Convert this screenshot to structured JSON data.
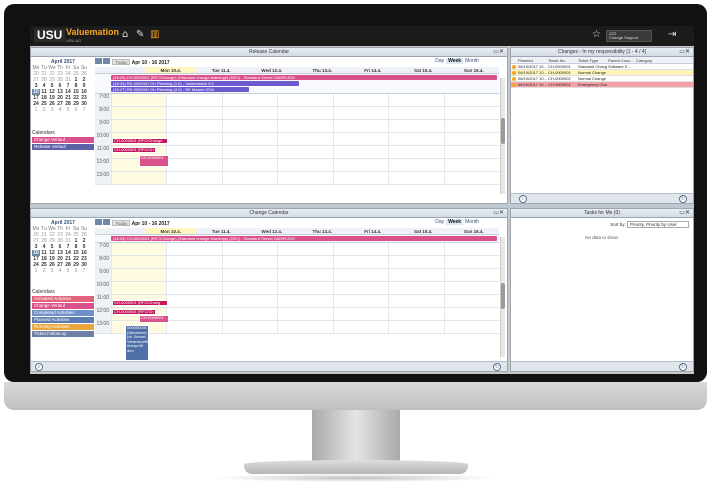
{
  "app": {
    "logo": "USU",
    "product": "Valuemation",
    "sub_product": "USU AG",
    "home_icon": "home-icon",
    "user_name": "ZZZ",
    "user_role": "Change Support",
    "star_icon": "star-icon",
    "logout_icon": "logout-icon"
  },
  "release_calendar": {
    "title": "Release Calendar",
    "range": "Apr 10 - 16 2017",
    "today_label": "Today",
    "views": [
      "Day",
      "Week",
      "Month"
    ],
    "active_view": "Week",
    "days": [
      "Mon 10.4.",
      "Tue 11.4.",
      "Wed 12.4.",
      "Thu 13.4.",
      "Fri 14.4.",
      "Sat 15.4.",
      "Sun 16.4."
    ],
    "hours": [
      "7:00",
      "8:00",
      "9:00",
      "10:00",
      "11:00",
      "12:00",
      "13:00"
    ],
    "all_day": [
      {
        "label": "(18:25) CH-0000001 (RFC/Change) (Standard change learnings) (DEV) - Standard Server SAMPLE00",
        "color": "#d9508a"
      },
      {
        "label": "(18:34) RE-0000001 On Planning (1.0) - Valuemation 5.0",
        "color": "#6a5acd"
      },
      {
        "label": "(18:27) RE-0000001 On Planning (4.0) - RE Master 2016",
        "color": "#6a5acd"
      }
    ],
    "events": [
      {
        "label": "CH-0000001 (RFC/Change",
        "color": "#c2185b"
      },
      {
        "label": "CH-0000001 (RFC/Ch",
        "color": "#c2185b"
      },
      {
        "label": "CH-0000001",
        "color": "#d9508a"
      }
    ],
    "mini_month": "April 2017",
    "calendars_label": "Calendars",
    "calendars": [
      {
        "label": "Change Verlauf",
        "color": "#d9508a"
      },
      {
        "label": "Release Verlauf",
        "color": "#5b62a8"
      }
    ]
  },
  "change_calendar": {
    "title": "Change Calendar",
    "range": "Apr 10 - 16 2017",
    "today_label": "Today",
    "views": [
      "Day",
      "Week",
      "Month"
    ],
    "active_view": "Week",
    "days": [
      "Mon 10.4.",
      "Tue 11.4.",
      "Wed 12.4.",
      "Thu 13.4.",
      "Fri 14.4.",
      "Sat 15.4.",
      "Sun 16.4."
    ],
    "hours": [
      "7:00",
      "8:00",
      "9:00",
      "10:00",
      "11:00",
      "12:00",
      "13:00"
    ],
    "all_day": [
      {
        "label": "(18:25) CH-0000001 (RFC/Change) (Standard change learnings) (DEV) - Standard Server SAMPLE00",
        "color": "#d9508a"
      }
    ],
    "events": [
      {
        "label": "CH-0000001 (RFC/Chang",
        "color": "#c2185b"
      },
      {
        "label": "CH-0000001 (RFC/Ch",
        "color": "#c2185b"
      },
      {
        "label": "CH-0000001",
        "color": "#d9508a"
      },
      {
        "label": "000000001 (Abnahme) (dr. Server-Verantwortlicher überprüft den",
        "color": "#4f6fa8"
      }
    ],
    "mini_month": "April 2017",
    "calendars_label": "Calendars",
    "calendars": [
      {
        "label": "Activated Activities",
        "color": "#e0637a"
      },
      {
        "label": "Change Verlauf",
        "color": "#d9508a"
      },
      {
        "label": "Completed Activities",
        "color": "#6f8fc9"
      },
      {
        "label": "Planned Activities",
        "color": "#5b7bb3"
      },
      {
        "label": "Running Activities",
        "color": "#e8a73c"
      },
      {
        "label": "Ticket Follow-up",
        "color": "#6d7fa6"
      }
    ]
  },
  "mini_calendar": {
    "weekdays": [
      "Mo",
      "Tu",
      "We",
      "Th",
      "Fr",
      "Sa",
      "Su"
    ],
    "weeks": [
      [
        "20",
        "21",
        "22",
        "23",
        "24",
        "25",
        "26"
      ],
      [
        "27",
        "28",
        "29",
        "30",
        "31",
        "1",
        "2"
      ],
      [
        "3",
        "4",
        "5",
        "6",
        "7",
        "8",
        "9"
      ],
      [
        "10",
        "11",
        "12",
        "13",
        "14",
        "15",
        "16"
      ],
      [
        "17",
        "18",
        "19",
        "20",
        "21",
        "22",
        "23"
      ],
      [
        "24",
        "25",
        "26",
        "27",
        "28",
        "29",
        "30"
      ],
      [
        "1",
        "2",
        "3",
        "4",
        "5",
        "6",
        "7"
      ]
    ]
  },
  "changes": {
    "title": "Changes - In my responsibility [1 - 4 / 4]",
    "columns": [
      "",
      "Planned",
      "Ticket No.",
      "Ticket Type",
      "Parent Conc...",
      "Category"
    ],
    "rows": [
      {
        "planned": "06/19/2017 10...",
        "ticket": "CH-0000001",
        "type": "Standard Change",
        "parent": "Software E...",
        "category": "",
        "bg": "#ffffff"
      },
      {
        "planned": "06/19/2017 10...",
        "ticket": "CH-0000001",
        "type": "Normal Change",
        "parent": "",
        "category": "",
        "bg": "#fff5b8"
      },
      {
        "planned": "06/19/2017 10...",
        "ticket": "CH-0000002",
        "type": "Normal Change",
        "parent": "",
        "category": "",
        "bg": "#ffffff"
      },
      {
        "planned": "06/19/2017 10...",
        "ticket": "CH-0000001",
        "type": "Emergency Cha...",
        "parent": "",
        "category": "",
        "bg": "#f4a3a8"
      }
    ]
  },
  "tasks": {
    "title": "Tasks for Me (0)",
    "sort_label": "Sort by:",
    "sort_value": "Priority, Priority by User",
    "empty": "No data to show."
  }
}
